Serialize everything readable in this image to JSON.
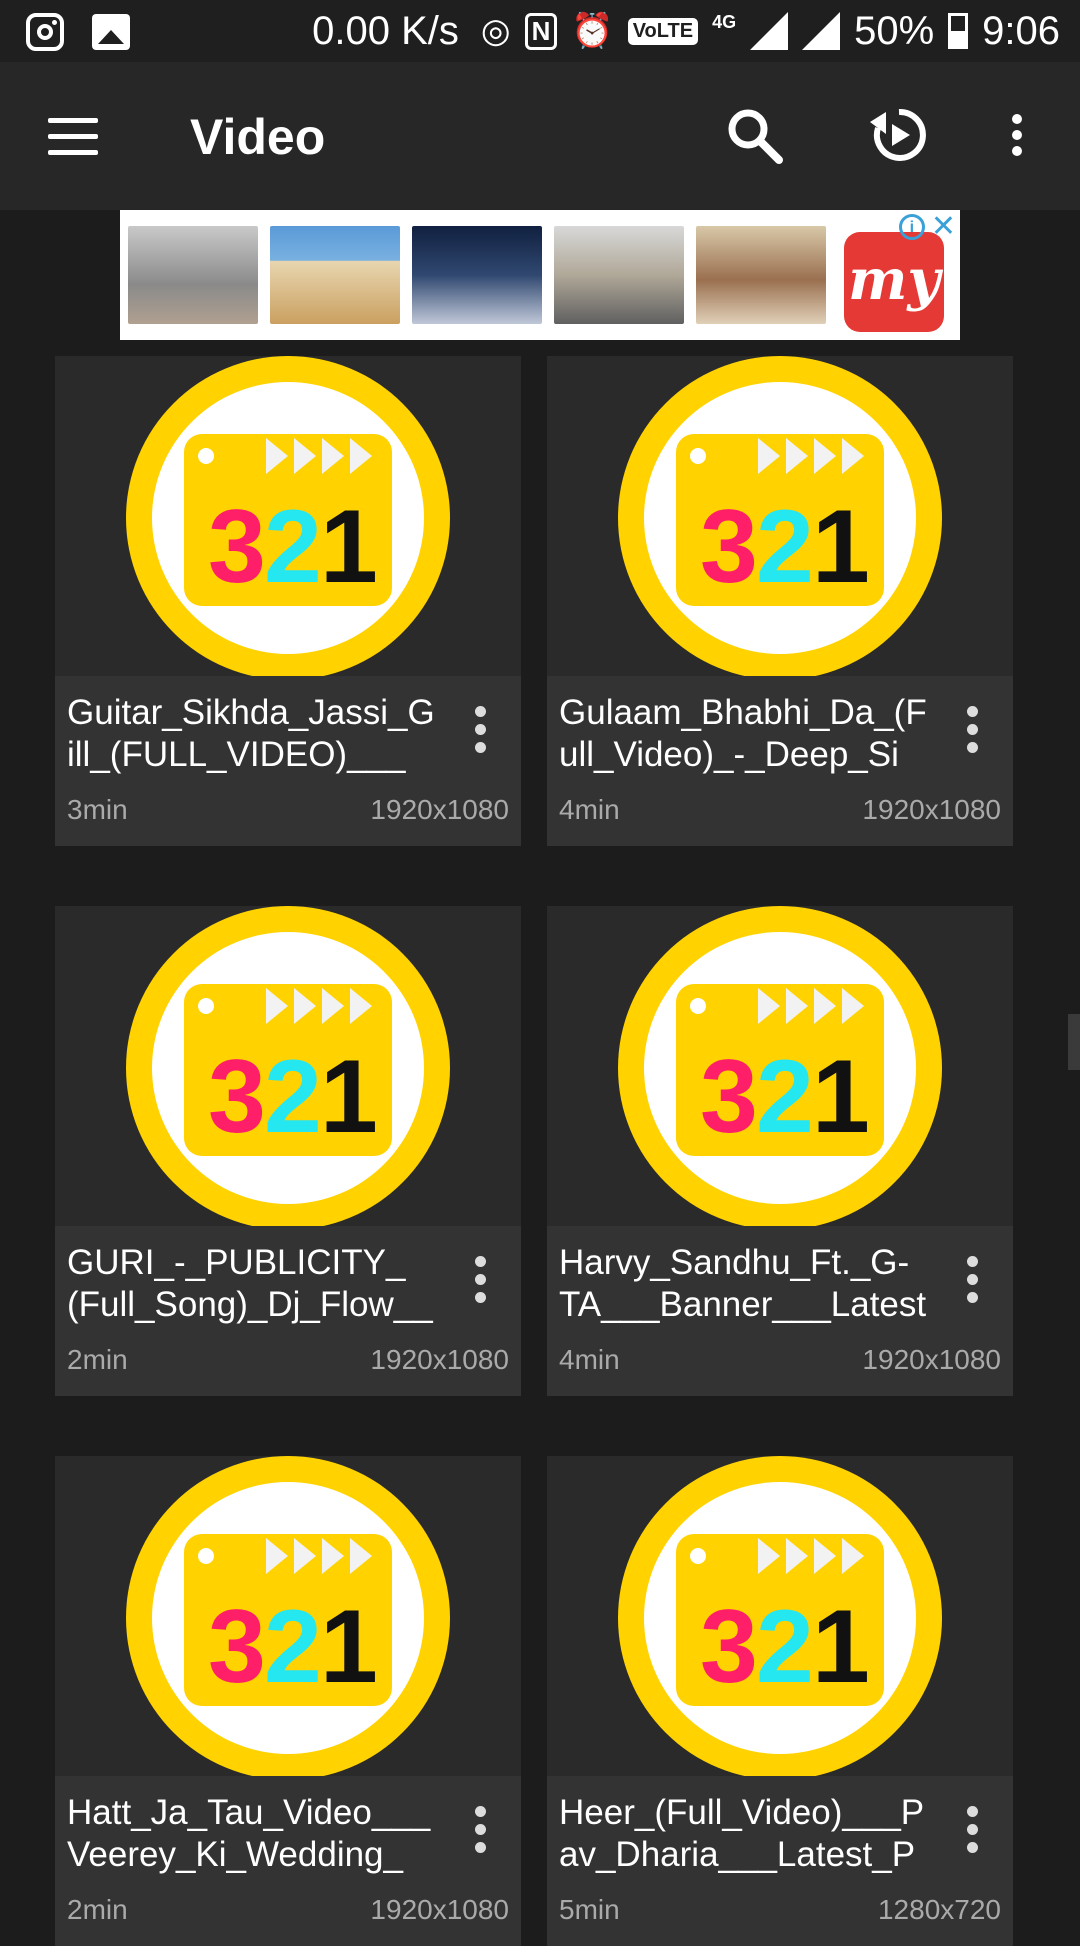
{
  "status_bar": {
    "speed": "0.00 K/s",
    "network": "4G",
    "volte": "VoLTE",
    "battery": "50%",
    "time": "9:06"
  },
  "app_bar": {
    "title": "Video"
  },
  "icons": {
    "menu": "menu-icon",
    "search": "search-icon",
    "replay": "replay-icon",
    "more": "more-vert-icon"
  },
  "ad": {
    "logo_text": "my"
  },
  "logo_digits": [
    "3",
    "2",
    "1"
  ],
  "videos": [
    {
      "title": "Guitar_Sikhda_Jassi_Gill_(FULL_VIDEO)___J...",
      "duration": "3min",
      "resolution": "1920x1080"
    },
    {
      "title": "Gulaam_Bhabhi_Da_(Full_Video)_-_Deep_Sid...",
      "duration": "4min",
      "resolution": "1920x1080"
    },
    {
      "title": "GURI_-_PUBLICITY_(Full_Song)_Dj_Flow___S...",
      "duration": "2min",
      "resolution": "1920x1080"
    },
    {
      "title": "Harvy_Sandhu_Ft._G-TA___Banner___Latest_...",
      "duration": "4min",
      "resolution": "1920x1080"
    },
    {
      "title": "Hatt_Ja_Tau_Video___Veerey_Ki_Wedding__...",
      "duration": "2min",
      "resolution": "1920x1080"
    },
    {
      "title": "Heer_(Full_Video)___Pav_Dharia___Latest_Pu...",
      "duration": "5min",
      "resolution": "1280x720"
    }
  ],
  "colors": {
    "background": "#1c1c1c",
    "app_bar": "#272727",
    "logo_yellow": "#ffd200",
    "digit_3": "#ff1f68",
    "digit_2": "#25e7f0",
    "digit_1": "#111111"
  }
}
